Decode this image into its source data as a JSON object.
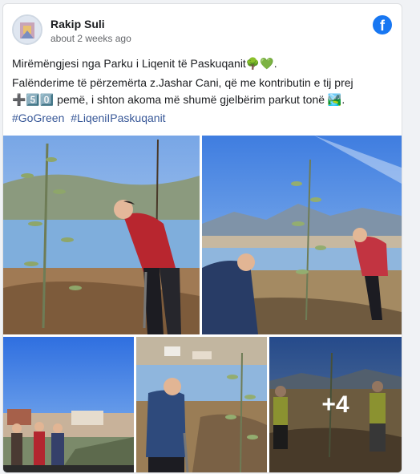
{
  "post": {
    "author": "Rakip Suli",
    "timestamp": "about 2 weeks ago",
    "line1": "Mirëmëngjesi nga Parku i Liqenit të Paskuqanit🌳💚.",
    "line2": "Falënderime të përzemërta z.Jashar Cani, që me kontributin e tij prej ➕5️⃣0️⃣ pemë, i shton akoma më shumë gjelbërim parkut tonë 🏞️.",
    "hashtags": [
      "#GoGreen",
      "#LiqeniIPaskuqanit"
    ],
    "more_photos": "+4"
  },
  "icons": {
    "platform": "facebook-icon"
  },
  "colors": {
    "brand": "#1877f2",
    "link": "#385898"
  }
}
